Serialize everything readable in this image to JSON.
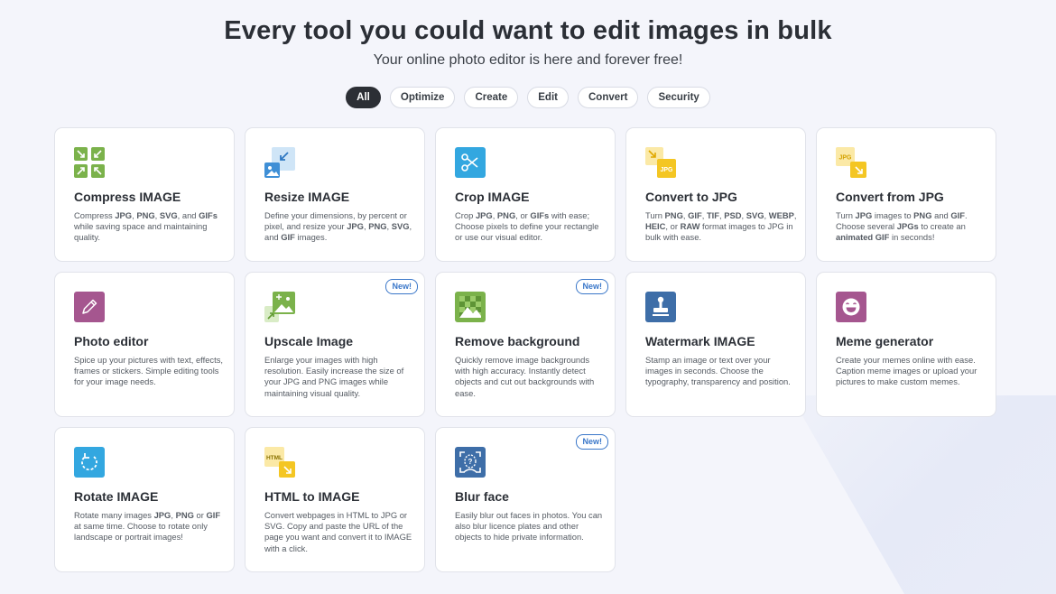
{
  "header": {
    "title": "Every tool you could want to edit images in bulk",
    "subtitle": "Your online photo editor is here and forever free!"
  },
  "filters": [
    "All",
    "Optimize",
    "Create",
    "Edit",
    "Convert",
    "Security"
  ],
  "active_filter": "All",
  "cards": [
    {
      "title": "Compress IMAGE",
      "icon": "compress-icon",
      "desc_html": "Compress <b>JPG</b>, <b>PNG</b>, <b>SVG</b>, and <b>GIFs</b> while saving space and maintaining quality."
    },
    {
      "title": "Resize IMAGE",
      "icon": "resize-icon",
      "desc_html": "Define your dimensions, by percent or pixel, and resize your <b>JPG</b>, <b>PNG</b>, <b>SVG</b>, and <b>GIF</b> images."
    },
    {
      "title": "Crop IMAGE",
      "icon": "scissors-icon",
      "desc_html": "Crop <b>JPG</b>, <b>PNG</b>, or <b>GIFs</b> with ease; Choose pixels to define your rectangle or use our visual editor."
    },
    {
      "title": "Convert to JPG",
      "icon": "convert-to-jpg-icon",
      "desc_html": "Turn <b>PNG</b>, <b>GIF</b>, <b>TIF</b>, <b>PSD</b>, <b>SVG</b>, <b>WEBP</b>, <b>HEIC</b>, or <b>RAW</b> format images to JPG in bulk with ease."
    },
    {
      "title": "Convert from JPG",
      "icon": "convert-from-jpg-icon",
      "desc_html": "Turn <b>JPG</b> images to <b>PNG</b> and <b>GIF</b>. Choose several <b>JPGs</b> to create an <b>animated GIF</b> in seconds!"
    },
    {
      "title": "Photo editor",
      "icon": "pencil-icon",
      "desc_html": "Spice up your pictures with text, effects, frames or stickers. Simple editing tools for your image needs."
    },
    {
      "title": "Upscale Image",
      "icon": "upscale-icon",
      "badge": "New!",
      "desc_html": "Enlarge your images with high resolution. Easily increase the size of your JPG and PNG images while maintaining visual quality."
    },
    {
      "title": "Remove background",
      "icon": "remove-background-icon",
      "badge": "New!",
      "desc_html": "Quickly remove image backgrounds with high accuracy. Instantly detect objects and cut out backgrounds with ease."
    },
    {
      "title": "Watermark IMAGE",
      "icon": "stamp-icon",
      "desc_html": "Stamp an image or text over your images in seconds. Choose the typography, transparency and position."
    },
    {
      "title": "Meme generator",
      "icon": "laughing-face-icon",
      "desc_html": "Create your memes online with ease. Caption meme images or upload your pictures to make custom memes."
    },
    {
      "title": "Rotate IMAGE",
      "icon": "rotate-icon",
      "desc_html": "Rotate many images <b>JPG</b>, <b>PNG</b> or <b>GIF</b> at same time. Choose to rotate only landscape or portrait images!"
    },
    {
      "title": "HTML to IMAGE",
      "icon": "html-to-image-icon",
      "desc_html": "Convert webpages in HTML to JPG or SVG. Copy and paste the URL of the page you want and convert it to IMAGE with a click."
    },
    {
      "title": "Blur face",
      "icon": "blur-face-icon",
      "badge": "New!",
      "desc_html": "Easily blur out faces in photos. You can also blur licence plates and other objects to hide private information."
    }
  ],
  "colors": {
    "compress": "#7bb24b",
    "resize": "#3f8fd6",
    "crop": "#33a7e0",
    "convert": "#f4c623",
    "photo_editor": "#a5568f",
    "remove_bg": "#7bb24b",
    "watermark": "#3e6ea8",
    "meme": "#a5568f",
    "rotate": "#33a7e0",
    "blur_face": "#3e6ea8",
    "badge": "#3a77c9"
  }
}
